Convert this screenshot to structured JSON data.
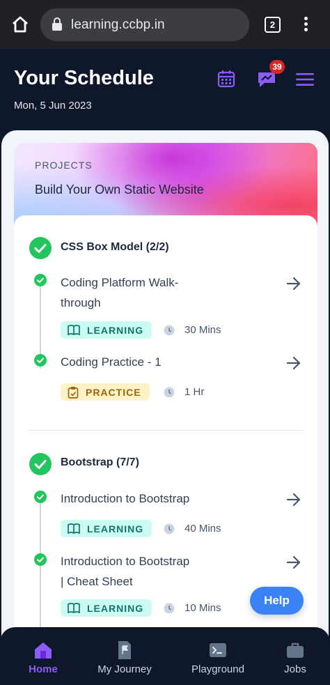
{
  "browser": {
    "url": "learning.ccbp.in",
    "tab_count": "2",
    "icons": [
      "home-icon",
      "lock-icon",
      "tabs-icon",
      "more-vert-icon"
    ]
  },
  "header": {
    "title": "Your Schedule",
    "date": "Mon, 5 Jun 2023",
    "notification_count": "39",
    "icons": [
      "calendar-icon",
      "chat-icon",
      "menu-icon"
    ],
    "accent_color": "#8b5cf6"
  },
  "project": {
    "label": "PROJECTS",
    "title": "Build Your Own Static Website"
  },
  "sections": [
    {
      "title": "CSS Box Model (2/2)",
      "items": [
        {
          "title_line1": "Coding Platform Walk-",
          "title_line2": "through",
          "tag": "LEARNING",
          "duration": "30 Mins"
        },
        {
          "title_line1": "Coding Practice - 1",
          "title_line2": "",
          "tag": "PRACTICE",
          "duration": "1 Hr"
        }
      ]
    },
    {
      "title": "Bootstrap (7/7)",
      "items": [
        {
          "title_line1": "Introduction to Bootstrap",
          "title_line2": "",
          "tag": "LEARNING",
          "duration": "40 Mins"
        },
        {
          "title_line1": "Introduction to Bootstrap",
          "title_line2": "| Cheat Sheet",
          "tag": "LEARNING",
          "duration": "10 Mins"
        }
      ]
    }
  ],
  "colors": {
    "complete_green": "#22c55e",
    "learning_bg": "#ccfbf1",
    "practice_bg": "#fef3c7",
    "help_blue": "#3b82f6",
    "nav_bg": "#0f172a"
  },
  "help_label": "Help",
  "nav": [
    {
      "label": "Home",
      "icon": "home-icon",
      "active": true
    },
    {
      "label": "My Journey",
      "icon": "flag-icon",
      "active": false
    },
    {
      "label": "Playground",
      "icon": "terminal-icon",
      "active": false
    },
    {
      "label": "Jobs",
      "icon": "briefcase-icon",
      "active": false
    }
  ]
}
